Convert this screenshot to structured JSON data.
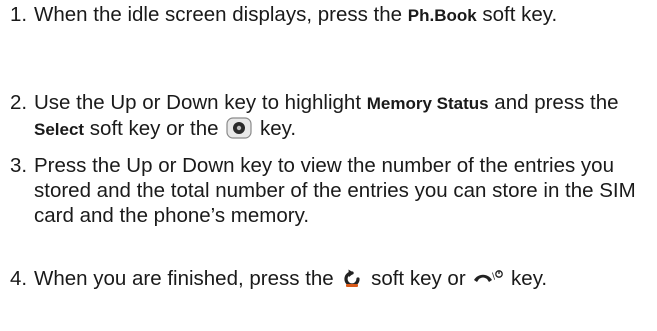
{
  "steps": [
    {
      "number": "1.",
      "parts": {
        "a": "When the idle screen displays, press the ",
        "b": "Ph.Book",
        "c": " soft key."
      }
    },
    {
      "number": "2.",
      "parts": {
        "a": "Use the Up or Down key to highlight ",
        "b": "Memory Status",
        "c": " and press the ",
        "d": "Select",
        "e": " soft key or the ",
        "f": " key."
      },
      "icon": "ok-key-icon"
    },
    {
      "number": "3.",
      "parts": {
        "a": "Press the Up or Down key to view the number of the entries you stored and the total number of the entries you can store in the SIM card and the phone’s memory."
      }
    },
    {
      "number": "4.",
      "parts": {
        "a": "When you are finished, press the ",
        "b": " soft key or ",
        "c": " key."
      },
      "icons": [
        "back-arrow-icon",
        "end-call-key-icon"
      ]
    }
  ]
}
